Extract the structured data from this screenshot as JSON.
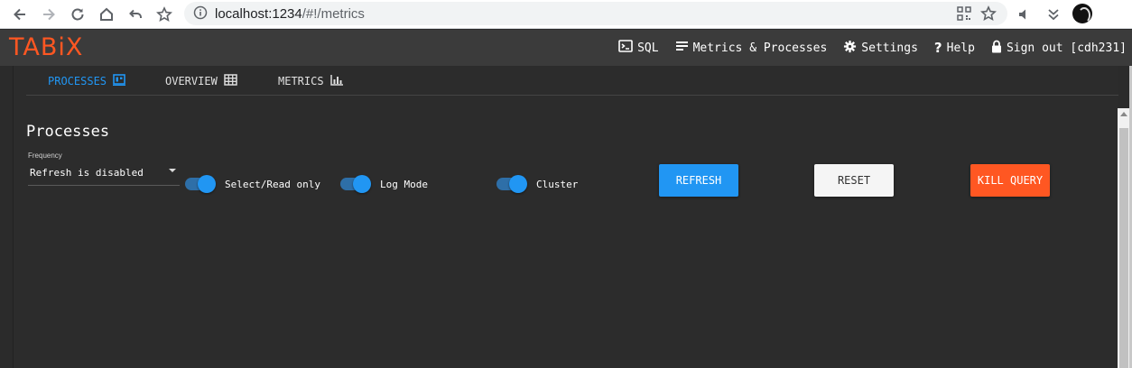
{
  "browser": {
    "url_host": "localhost:1234",
    "url_path": "/#!/metrics"
  },
  "app": {
    "logo": "TABiX",
    "nav": [
      {
        "label": "SQL",
        "icon": "terminal-icon"
      },
      {
        "label": "Metrics & Processes",
        "icon": "list-icon"
      },
      {
        "label": "Settings",
        "icon": "gear-icon"
      },
      {
        "label": "Help",
        "icon": "question-icon"
      },
      {
        "label": "Sign out [cdh231]",
        "icon": "lock-icon"
      }
    ]
  },
  "tabs": [
    {
      "label": "PROCESSES",
      "icon": "processes-icon",
      "active": true
    },
    {
      "label": "OVERVIEW",
      "icon": "table-icon",
      "active": false
    },
    {
      "label": "METRICS",
      "icon": "bar-chart-icon",
      "active": false
    }
  ],
  "page": {
    "title": "Processes",
    "frequency_label": "Frequency",
    "frequency_value": "Refresh is disabled"
  },
  "toggles": [
    {
      "label": "Select/Read only",
      "on": true
    },
    {
      "label": "Log Mode",
      "on": true
    },
    {
      "label": "Cluster",
      "on": true
    }
  ],
  "buttons": {
    "refresh": "REFRESH",
    "reset": "RESET",
    "kill": "KILL QUERY"
  },
  "colors": {
    "accent": "#2196f3",
    "brand": "#ff5722",
    "background": "#2b2b2b"
  }
}
